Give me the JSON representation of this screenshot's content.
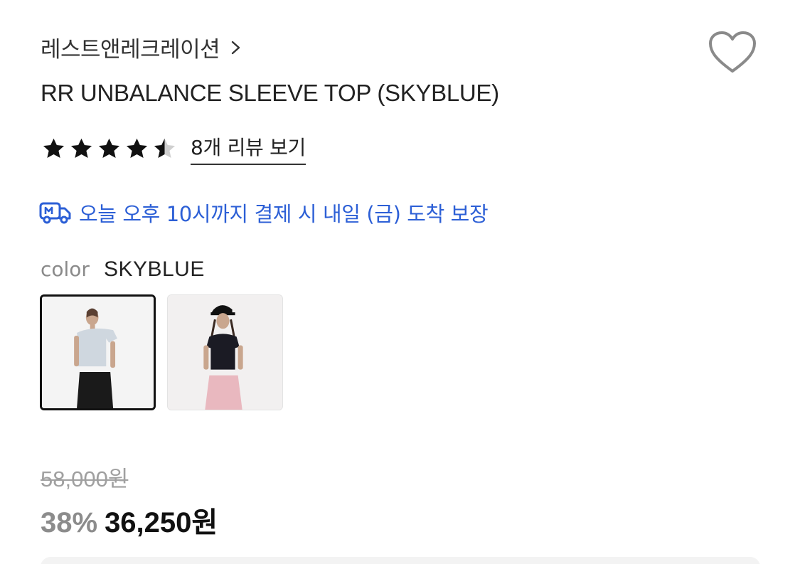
{
  "brand": {
    "name": "레스트앤레크레이션",
    "chevron_icon": "chevron-right-icon"
  },
  "wishlist": {
    "icon": "heart-outline-icon"
  },
  "product": {
    "title": "RR UNBALANCE SLEEVE TOP (SKYBLUE)"
  },
  "rating": {
    "value": 4.5,
    "max": 5,
    "review_link": "8개 리뷰 보기"
  },
  "delivery": {
    "icon": "delivery-truck-icon",
    "text": "오늘 오후 10시까지 결제 시 내일 (금) 도착 보장",
    "color": "#2c5fd6"
  },
  "color": {
    "label": "color",
    "value": "SKYBLUE"
  },
  "thumbnails": [
    {
      "name": "skyblue",
      "selected": true
    },
    {
      "name": "black",
      "selected": false
    }
  ],
  "price": {
    "original": "58,000원",
    "discount": "38%",
    "sale": "36,250원"
  }
}
